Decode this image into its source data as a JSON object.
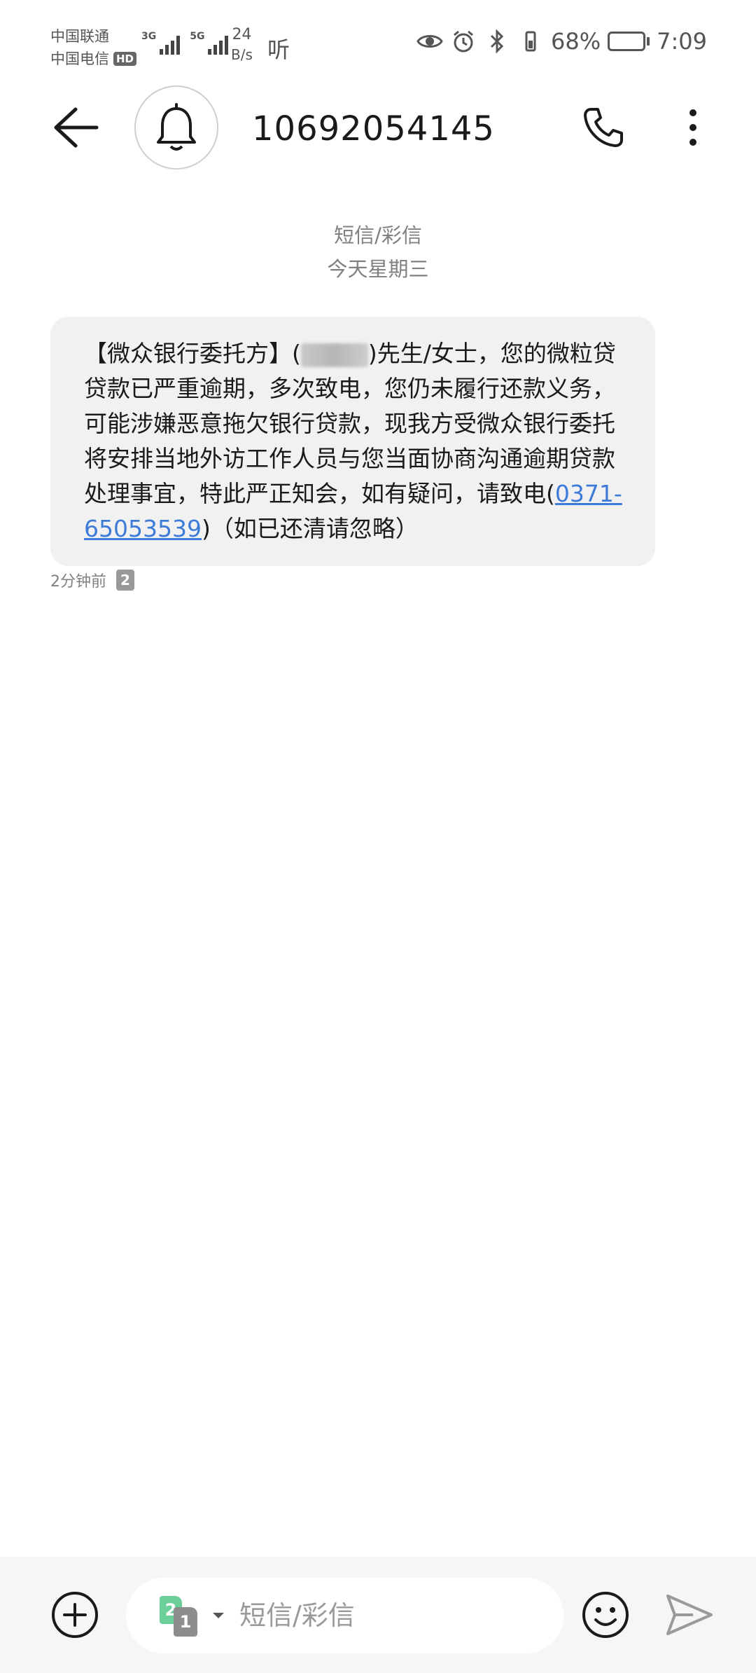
{
  "status_bar": {
    "carrier_1": "中国联通",
    "carrier_2": "中国电信",
    "hd_label": "HD",
    "network_1": "3G",
    "network_2": "5G",
    "speed_value": "24",
    "speed_unit": "B/s",
    "listen_glyph": "听",
    "battery_percent": "68%",
    "battery_level": 0.68,
    "time": "7:09",
    "icons": [
      "eye-icon",
      "alarm-icon",
      "bluetooth-icon",
      "vibrate-icon",
      "battery-icon"
    ]
  },
  "header": {
    "contact_number": "10692054145",
    "icons": [
      "back-arrow-icon",
      "bell-icon",
      "phone-icon",
      "more-vertical-icon"
    ]
  },
  "thread": {
    "message_type": "短信/彩信",
    "date_label": "今天星期三",
    "message": {
      "text_before_name": "【微众银行委托方】(",
      "text_after_name": ")先生/女士，您的微粒贷贷款已严重逾期，多次致电，您仍未履行还款义务，可能涉嫌恶意拖欠银行贷款，现我方受微众银行委托将安排当地外访工作人员与您当面协商沟通逾期贷款处理事宜，特此严正知会，如有疑问，请致电(",
      "phone_link": "0371-65053539",
      "text_after_link": ")（如已还清请忽略）",
      "time_ago": "2分钟前",
      "sim_slot": "2"
    }
  },
  "composer": {
    "placeholder": "短信/彩信",
    "sim_primary": "2",
    "sim_secondary": "1",
    "icons": [
      "add-circle-icon",
      "sim-switch-icon",
      "emoji-icon",
      "send-icon"
    ],
    "accent_color": "#6ccf9a"
  }
}
